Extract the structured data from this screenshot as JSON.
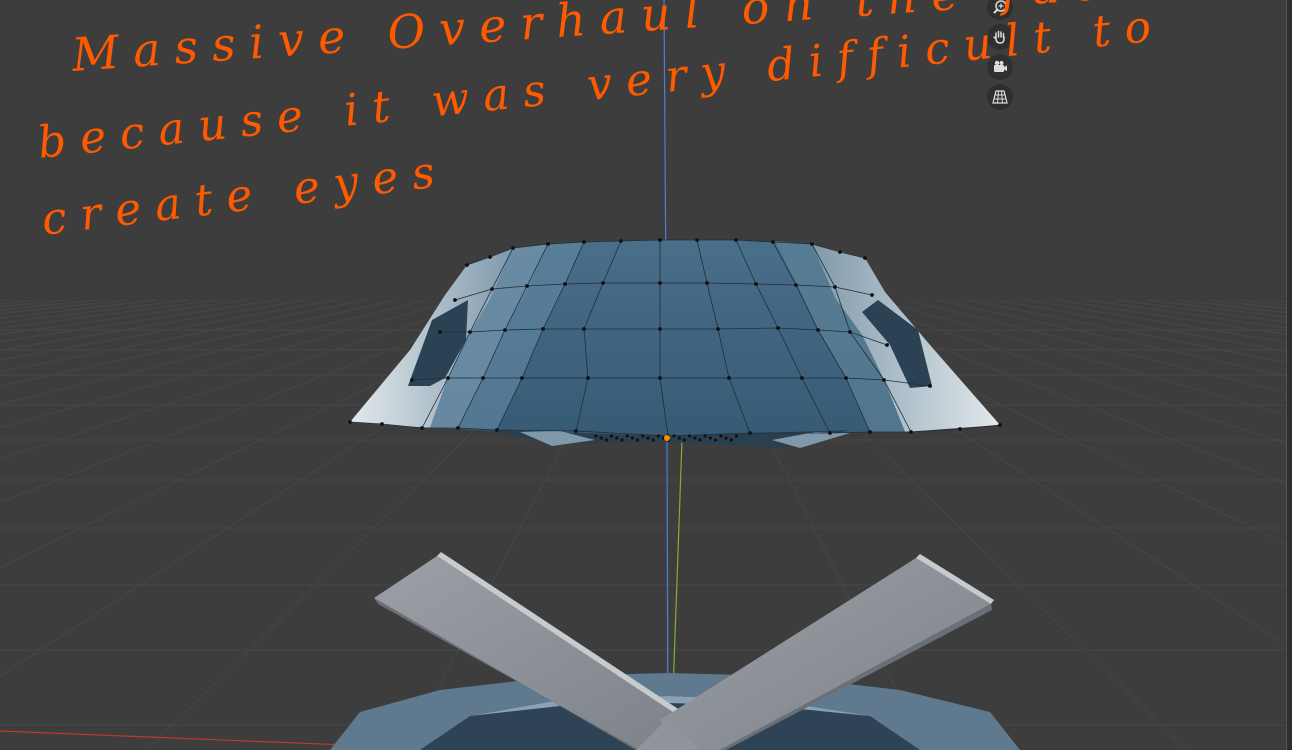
{
  "annotation": {
    "line1": "Massive Overhaul on the face",
    "line2": "because it was very difficult to",
    "line3": "create eyes"
  },
  "navigation_gizmo": [
    {
      "name": "zoom-icon",
      "label": "zoom"
    },
    {
      "name": "hand-pan-icon",
      "label": "pan"
    },
    {
      "name": "camera-icon",
      "label": "camera view"
    },
    {
      "name": "grid-ortho-icon",
      "label": "orthographic view"
    }
  ],
  "colors": {
    "background": "#3d3d3d",
    "grid": "#484848",
    "axis_z": "#4a7fd0",
    "axis_y": "#7fae3a",
    "axis_x": "#c0392b",
    "mesh_face": "#3f6480",
    "mesh_side": "#a9c0cf",
    "annotation": "#ff5a00",
    "selected_origin": "#ff8a00"
  }
}
